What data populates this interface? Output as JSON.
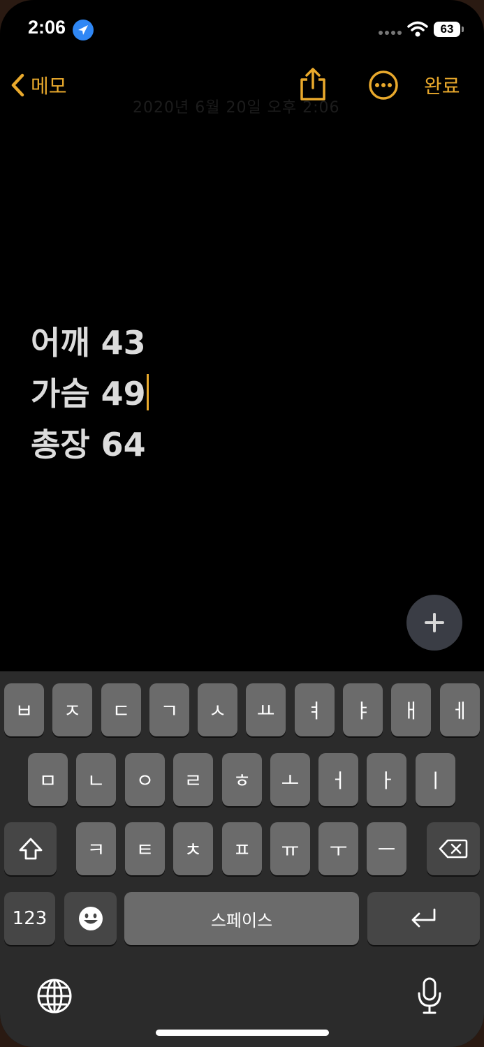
{
  "status_bar": {
    "time": "2:06",
    "battery": "63"
  },
  "nav": {
    "back_label": "메모",
    "done_label": "완료",
    "faded_date": "2020년 6월 20일 오후 2:06"
  },
  "note": {
    "lines": [
      "어깨 43",
      "가슴 49",
      "총장 64"
    ]
  },
  "keyboard": {
    "row1": [
      "ㅂ",
      "ㅈ",
      "ㄷ",
      "ㄱ",
      "ㅅ",
      "ㅛ",
      "ㅕ",
      "ㅑ",
      "ㅐ",
      "ㅔ"
    ],
    "row2": [
      "ㅁ",
      "ㄴ",
      "ㅇ",
      "ㄹ",
      "ㅎ",
      "ㅗ",
      "ㅓ",
      "ㅏ",
      "ㅣ"
    ],
    "row3": [
      "ㅋ",
      "ㅌ",
      "ㅊ",
      "ㅍ",
      "ㅠ",
      "ㅜ",
      "ㅡ"
    ],
    "numbers_label": "123",
    "space_label": "스페이스"
  },
  "colors": {
    "accent": "#e9a92c",
    "location": "#2f87f5",
    "key": "#6b6b6b",
    "key_dark": "#464646"
  },
  "icons": [
    "location-arrow-icon",
    "wifi-icon",
    "chevron-left-icon",
    "share-icon",
    "more-icon",
    "plus-icon",
    "shift-icon",
    "backspace-icon",
    "emoji-icon",
    "return-icon",
    "globe-icon",
    "mic-icon"
  ]
}
